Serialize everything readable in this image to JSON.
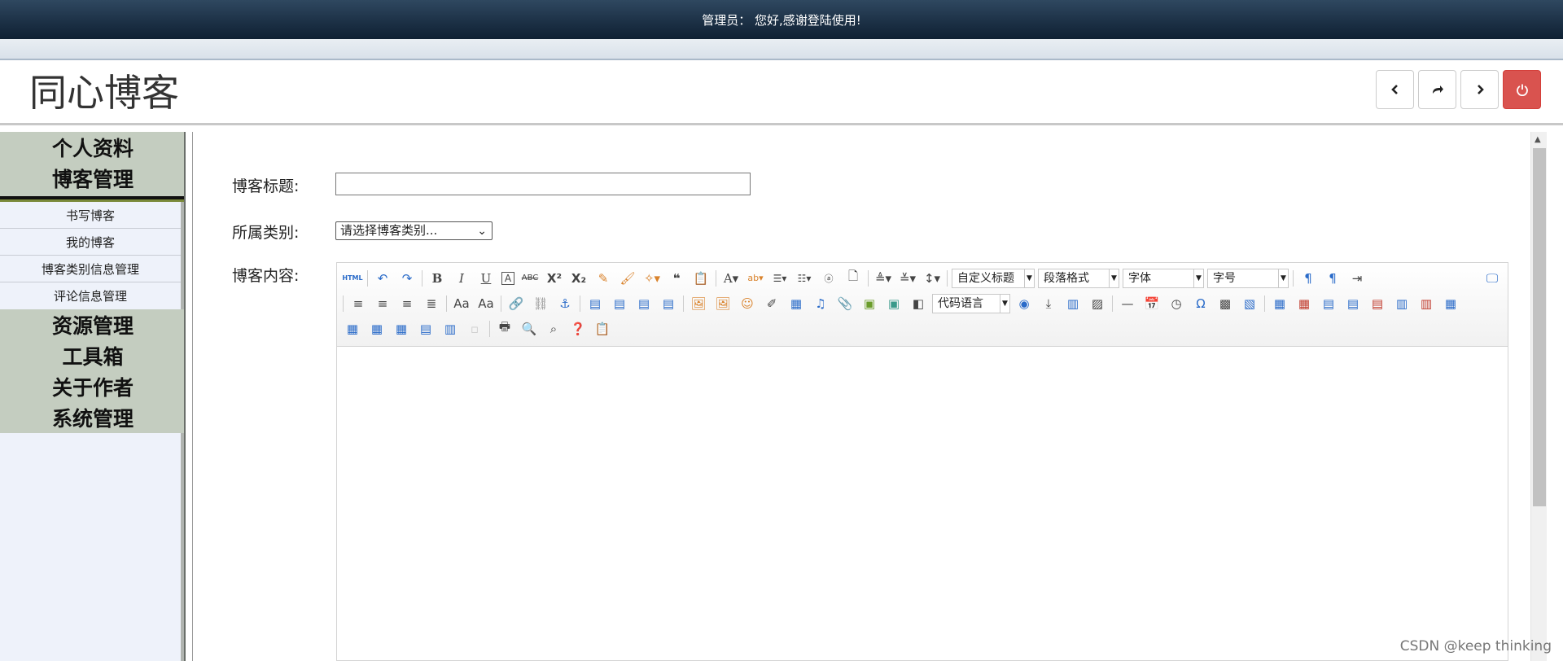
{
  "topbar": {
    "greeting": "管理员： 您好,感谢登陆使用!"
  },
  "header": {
    "site_title": "同心博客",
    "buttons": [
      {
        "name": "back-button",
        "icon": "chevron-left-icon"
      },
      {
        "name": "forward-share-button",
        "icon": "share-arrow-icon"
      },
      {
        "name": "next-button",
        "icon": "chevron-right-icon"
      },
      {
        "name": "logout-button",
        "icon": "power-icon",
        "color": "#d9534f"
      }
    ]
  },
  "sidebar": {
    "groups": [
      {
        "label": "个人资料"
      },
      {
        "label": "博客管理",
        "expanded": true,
        "items": [
          "书写博客",
          "我的博客",
          "博客类别信息管理",
          "评论信息管理"
        ]
      },
      {
        "label": "资源管理"
      },
      {
        "label": "工具箱"
      },
      {
        "label": "关于作者"
      },
      {
        "label": "系统管理"
      }
    ]
  },
  "form": {
    "title_label": "博客标题:",
    "title_value": "",
    "category_label": "所属类别:",
    "category_selected": "请选择博客类别...",
    "content_label": "博客内容:"
  },
  "editor": {
    "dropdowns": {
      "custom_heading": "自定义标题",
      "paragraph_format": "段落格式",
      "font_family": "字体",
      "font_size": "字号",
      "code_language": "代码语言"
    },
    "html_label": "HTML"
  },
  "watermark": "CSDN @keep   thinking"
}
